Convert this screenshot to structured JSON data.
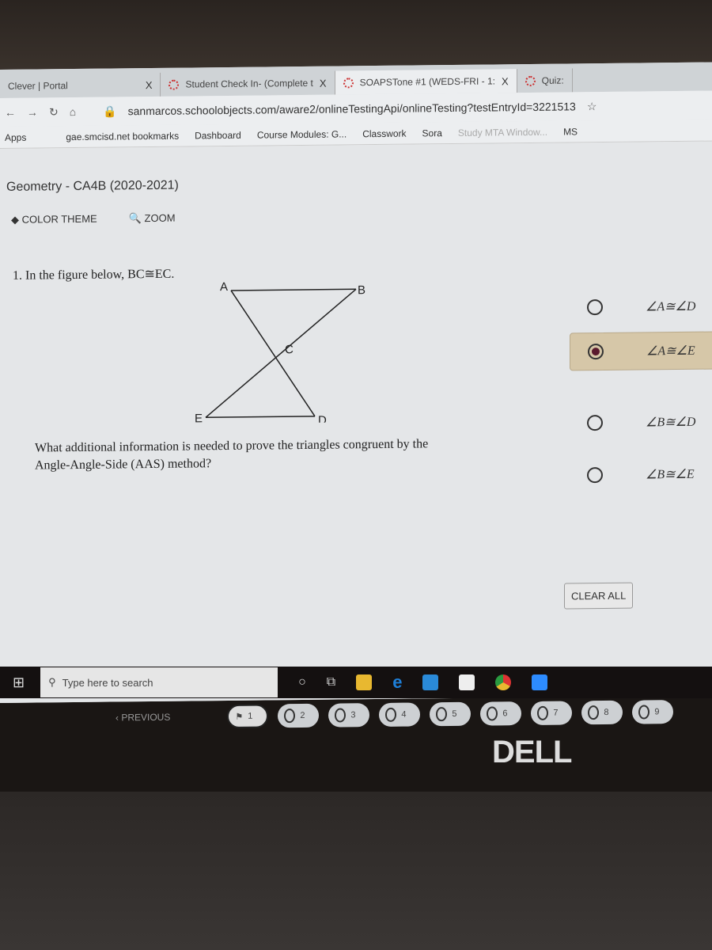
{
  "browser": {
    "tabs": [
      {
        "label": "Clever | Portal",
        "close": "X"
      },
      {
        "label": "Student Check In- (Complete t",
        "close": "X"
      },
      {
        "label": "SOAPSTone #1 (WEDS-FRI - 1:",
        "close": "X"
      },
      {
        "label": "Quiz:"
      }
    ],
    "url": "sanmarcos.schoolobjects.com/aware2/onlineTestingApi/onlineTesting?testEntryId=3221513",
    "bookmarks": [
      "Apps",
      "gae.smcisd.net bookmarks",
      "Dashboard",
      "Course Modules: G...",
      "Classwork",
      "Sora",
      "Study MTA Window...",
      "MS"
    ]
  },
  "course_title": "Geometry - CA4B (2020-2021)",
  "tools": {
    "color_theme": "COLOR THEME",
    "zoom": "ZOOM"
  },
  "question": {
    "text": "1. In the figure below, BC≅EC.",
    "figure_labels": {
      "A": "A",
      "B": "B",
      "C": "C",
      "D": "D",
      "E": "E"
    },
    "prompt_line1": "What additional information is needed to prove the triangles congruent by the",
    "prompt_line2": "Angle-Angle-Side (AAS) method?",
    "options": [
      {
        "label": "∠A≅∠D",
        "selected": false
      },
      {
        "label": "∠A≅∠E",
        "selected": true
      },
      {
        "label": "∠B≅∠D",
        "selected": false
      },
      {
        "label": "∠B≅∠E",
        "selected": false
      }
    ],
    "clear_all": "CLEAR ALL"
  },
  "nav": {
    "previous": "‹  PREVIOUS",
    "questions": [
      "1",
      "2",
      "3",
      "4",
      "5",
      "6",
      "7",
      "8",
      "9"
    ],
    "current": "1"
  },
  "taskbar": {
    "search_placeholder": "Type here to search"
  },
  "brand": "DELL",
  "colors": {
    "selected_option": "#d6c7a8",
    "selected_dot": "#5a1a2e"
  }
}
